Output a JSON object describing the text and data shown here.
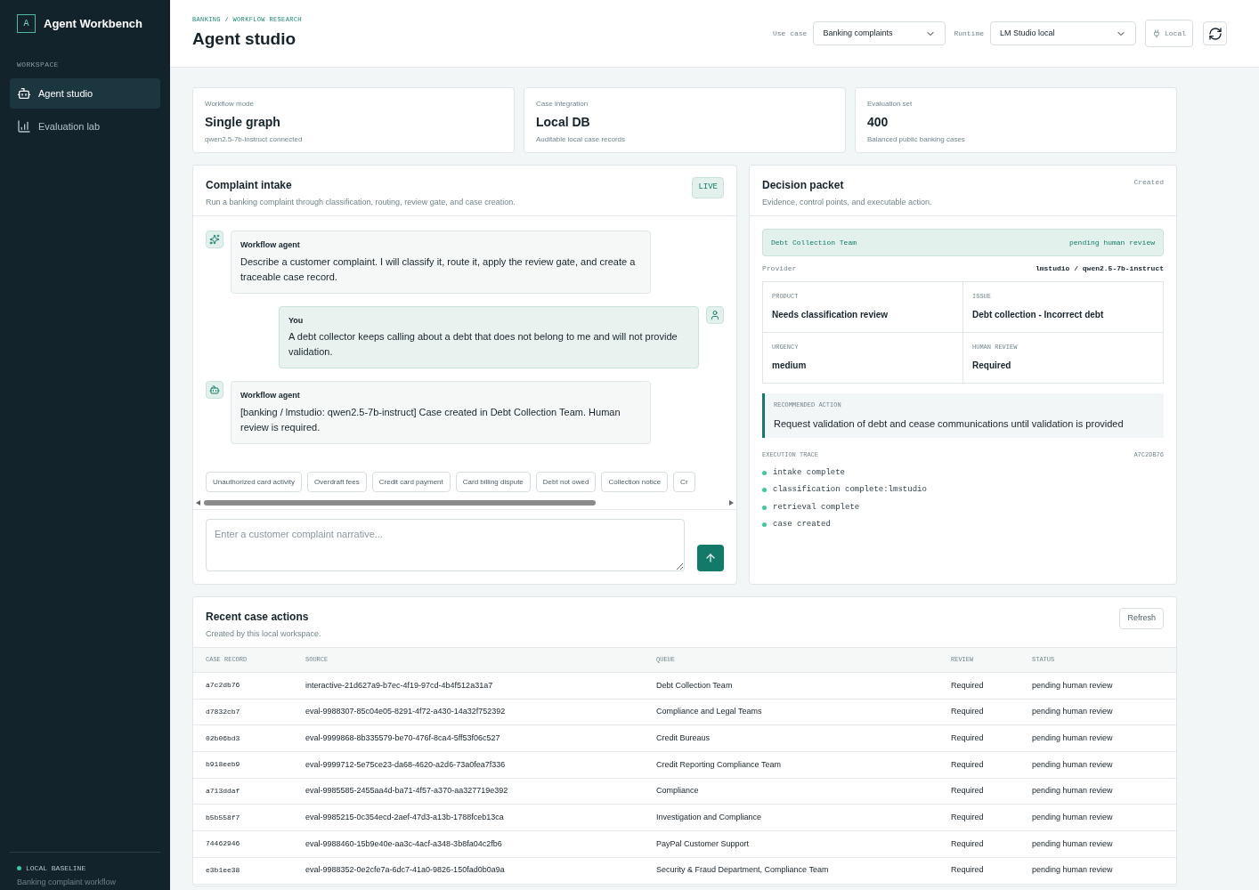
{
  "sidebar": {
    "logo_letter": "A",
    "title": "Agent Workbench",
    "section_label": "WORKSPACE",
    "items": [
      {
        "label": "Agent studio",
        "kind": "bot",
        "selected": true
      },
      {
        "label": "Evaluation lab",
        "kind": "chart",
        "selected": false
      }
    ],
    "footer_status": "LOCAL BASELINE",
    "footer_text": "Banking complaint workflow"
  },
  "header": {
    "breadcrumb": "BANKING / WORKFLOW RESEARCH",
    "title": "Agent studio",
    "use_case_label": "Use case",
    "use_case_value": "Banking complaints",
    "runtime_label": "Runtime",
    "runtime_value": "LM Studio local",
    "local_button": "Local"
  },
  "stats": [
    {
      "label": "Workflow mode",
      "value": "Single graph",
      "note": "qwen2.5-7b-instruct connected"
    },
    {
      "label": "Case integration",
      "value": "Local DB",
      "note": "Auditable local case records"
    },
    {
      "label": "Evaluation set",
      "value": "400",
      "note": "Balanced public banking cases"
    }
  ],
  "intake": {
    "title": "Complaint intake",
    "subtitle": "Run a banking complaint through classification, routing, review gate, and case creation.",
    "badge": "LIVE",
    "messages": [
      {
        "kind": "greeting",
        "author": "Workflow agent",
        "text": "Describe a customer complaint. I will classify it, route it, apply the review gate, and create a traceable case record."
      },
      {
        "kind": "user",
        "author": "You",
        "text": "A debt collector keeps calling about a debt that does not belong to me and will not provide validation."
      },
      {
        "kind": "result",
        "author": "Workflow agent",
        "text": "[banking / lmstudio: qwen2.5-7b-instruct] Case created in Debt Collection Team. Human review is required."
      }
    ],
    "chips": [
      "Unauthorized card activity",
      "Overdraft fees",
      "Credit card payment",
      "Card billing dispute",
      "Debt not owed",
      "Collection notice",
      "Cr"
    ],
    "input_placeholder": "Enter a customer complaint narrative..."
  },
  "decision": {
    "title": "Decision packet",
    "subtitle": "Evidence, control points, and executable action.",
    "status": "Created",
    "queue": "Debt Collection Team",
    "queue_status": "pending human review",
    "provider_label": "Provider",
    "provider_value": "lmstudio / qwen2.5-7b-instruct",
    "fields": [
      {
        "label": "PRODUCT",
        "value": "Needs classification review"
      },
      {
        "label": "ISSUE",
        "value": "Debt collection - Incorrect debt"
      },
      {
        "label": "URGENCY",
        "value": "medium"
      },
      {
        "label": "HUMAN REVIEW",
        "value": "Required"
      }
    ],
    "action_label": "RECOMMENDED ACTION",
    "action_text": "Request validation of debt and cease communications until validation is provided",
    "trace_label": "EXECUTION TRACE",
    "trace_id": "A7C2DB76",
    "trace": [
      "intake complete",
      "classification complete:lmstudio",
      "retrieval complete",
      "case created"
    ]
  },
  "recent": {
    "title": "Recent case actions",
    "subtitle": "Created by this local workspace.",
    "refresh": "Refresh",
    "columns": [
      "CASE RECORD",
      "SOURCE",
      "QUEUE",
      "REVIEW",
      "STATUS"
    ],
    "rows": [
      [
        "a7c2db76",
        "interactive-21d627a9-b7ec-4f19-97cd-4b4f512a31a7",
        "Debt Collection Team",
        "Required",
        "pending human review"
      ],
      [
        "d7832cb7",
        "eval-9988307-85c04e05-8291-4f72-a430-14a32f752392",
        "Compliance and Legal Teams",
        "Required",
        "pending human review"
      ],
      [
        "02b06bd3",
        "eval-9999868-8b335579-be70-476f-8ca4-5ff53f06c527",
        "Credit Bureaus",
        "Required",
        "pending human review"
      ],
      [
        "b918eeb9",
        "eval-9999712-5e75ce23-da68-4620-a2d6-73a0fea7f336",
        "Credit Reporting Compliance Team",
        "Required",
        "pending human review"
      ],
      [
        "a713ddaf",
        "eval-9985585-2455aa4d-ba71-4f57-a370-aa327719e392",
        "Compliance",
        "Required",
        "pending human review"
      ],
      [
        "b5b558f7",
        "eval-9985215-0c354ecd-2aef-47d3-a13b-1788fceb13ca",
        "Investigation and Compliance",
        "Required",
        "pending human review"
      ],
      [
        "74462946",
        "eval-9988460-15b9e40e-aa3c-4acf-a348-3b8fa04c2fb6",
        "PayPal Customer Support",
        "Required",
        "pending human review"
      ],
      [
        "e3b1ee38",
        "eval-9988352-0e2cfe7a-6dc7-41a0-9826-150fad0b0a9a",
        "Security & Fraud Department, Compliance Team",
        "Required",
        "pending human review"
      ]
    ]
  }
}
